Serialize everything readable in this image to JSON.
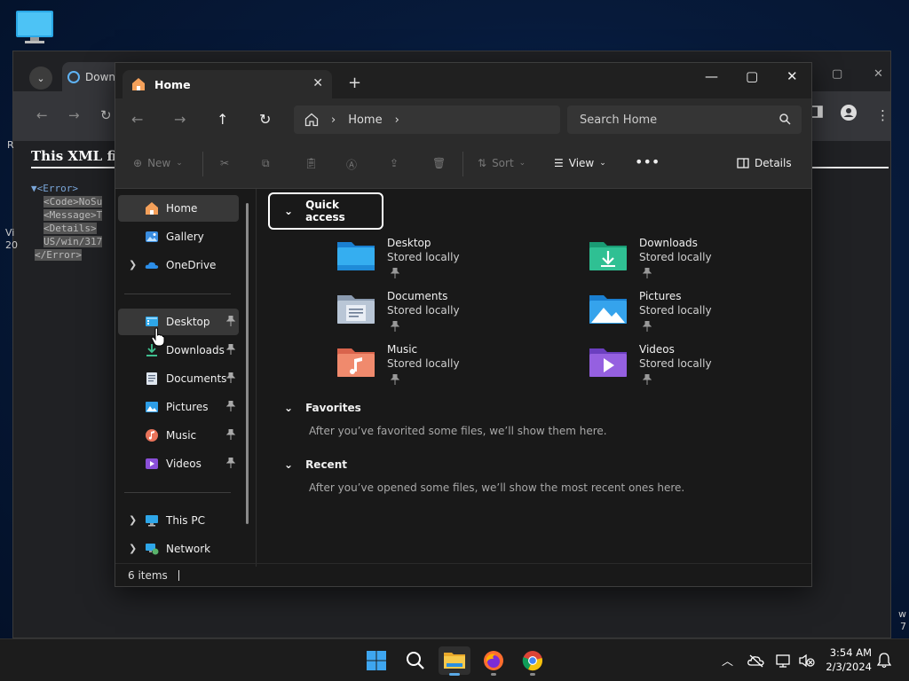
{
  "desktop": {
    "icon": "monitor-icon"
  },
  "browser": {
    "tab_label": "Downl",
    "xml_heading": "This XML file",
    "xml_lines": [
      {
        "tag": "▼<Error>"
      },
      {
        "sel": "<Code>NoSu"
      },
      {
        "sel": "<Message>T"
      },
      {
        "sel": "<Details>"
      },
      {
        "sel": "US/win/317"
      },
      {
        "sel": "</Error>"
      }
    ],
    "edge_left": [
      "R",
      "Vi",
      "20"
    ],
    "edge_right": [
      "w",
      "7"
    ]
  },
  "explorer": {
    "tab_title": "Home",
    "address": {
      "crumb": "Home"
    },
    "search": {
      "placeholder": "Search Home"
    },
    "toolbar": {
      "new": "New",
      "sort": "Sort",
      "view": "View",
      "details": "Details"
    },
    "sidebar": {
      "top": [
        {
          "label": "Home",
          "icon": "home-icon",
          "selected": true
        },
        {
          "label": "Gallery",
          "icon": "gallery-icon"
        },
        {
          "label": "OneDrive",
          "icon": "onedrive-icon",
          "expandable": true
        }
      ],
      "pinned": [
        {
          "label": "Desktop",
          "icon": "desktop-folder-icon",
          "hover": true
        },
        {
          "label": "Downloads",
          "icon": "downloads-icon"
        },
        {
          "label": "Documents",
          "icon": "documents-icon"
        },
        {
          "label": "Pictures",
          "icon": "pictures-icon"
        },
        {
          "label": "Music",
          "icon": "music-icon"
        },
        {
          "label": "Videos",
          "icon": "videos-icon"
        }
      ],
      "bottom": [
        {
          "label": "This PC",
          "icon": "this-pc-icon"
        },
        {
          "label": "Network",
          "icon": "network-icon"
        }
      ]
    },
    "main": {
      "quick_access": {
        "title": "Quick access",
        "items": [
          {
            "name": "Desktop",
            "sub": "Stored locally",
            "icon": "desktop-folder-icon"
          },
          {
            "name": "Downloads",
            "sub": "Stored locally",
            "icon": "downloads-folder-icon"
          },
          {
            "name": "Documents",
            "sub": "Stored locally",
            "icon": "documents-folder-icon"
          },
          {
            "name": "Pictures",
            "sub": "Stored locally",
            "icon": "pictures-folder-icon"
          },
          {
            "name": "Music",
            "sub": "Stored locally",
            "icon": "music-folder-icon"
          },
          {
            "name": "Videos",
            "sub": "Stored locally",
            "icon": "videos-folder-icon"
          }
        ]
      },
      "favorites": {
        "title": "Favorites",
        "empty": "After you’ve favorited some files, we’ll show them here."
      },
      "recent": {
        "title": "Recent",
        "empty": "After you’ve opened some files, we’ll show the most recent ones here."
      }
    },
    "status": {
      "items": "6 items"
    }
  },
  "taskbar": {
    "apps": [
      "start-icon",
      "search-icon",
      "file-explorer-icon",
      "firefox-icon",
      "chrome-icon"
    ],
    "clock": {
      "time": "3:54 AM",
      "date": "2/3/2024"
    }
  }
}
